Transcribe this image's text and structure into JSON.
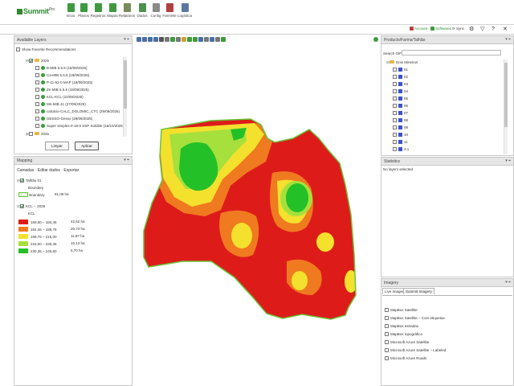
{
  "app": {
    "name": "Summit",
    "name_suffix": "Pro",
    "ribbon": [
      {
        "label": "Início",
        "icon": "home-icon",
        "color": "#3f9a3f"
      },
      {
        "label": "Planos",
        "icon": "plans-icon",
        "color": "#3f9a3f"
      },
      {
        "label": "Registros",
        "icon": "records-icon",
        "color": "#3f9a3f"
      },
      {
        "label": "Mapas",
        "icon": "maps-icon",
        "color": "#3f9a3f"
      },
      {
        "label": "Relatórios",
        "icon": "reports-icon",
        "color": "#7a8a5a"
      },
      {
        "label": "Dados",
        "icon": "data-icon",
        "color": "#4f8f4f"
      },
      {
        "label": "Config",
        "icon": "config-icon",
        "color": "#8a8a8a"
      },
      {
        "label": "FarmWe",
        "icon": "farmwe-icon",
        "color": "#b04040"
      },
      {
        "label": "Logística",
        "icon": "logistics-icon",
        "color": "#5a7aa0"
      }
    ]
  },
  "status_bar": {
    "account": "Account",
    "sw": "Softwares",
    "sync": "Sync",
    "account_color": "#c04040",
    "sw_color": "#3f9a3f"
  },
  "layers_panel": {
    "title": "Available Layers",
    "show_fav": "Show Favorite Recommendations",
    "year": "2025",
    "items": [
      "B-MIB 5.5.5 (18/09/2025)",
      "Ca-MIB 5.5.5 (18/09/2025)",
      "P-11-52-0 MAP (18/09/2025)",
      "Zn-MIB 5.5.5 (18/09/2025)",
      "KCL-KCL (22/09/2025)",
      "Mn-MIB 41 (27/09/2025)",
      "calcário-CALC_DOLOMIC_CTC (29/09/2025)",
      "GESSO-Gesso (29/09/2025)",
      "Super simples-0-18-0 SSP Solúble (16/10/2025)"
    ],
    "next_year": "2026",
    "btn_clear": "Limpar",
    "btn_apply": "Aplicar"
  },
  "mapping_panel": {
    "title": "Mapping",
    "menu": [
      "Camadas",
      "Editar dados",
      "Exportar"
    ],
    "field_name": "Talhão 01",
    "boundary_header": "Boundary",
    "boundary_label": "Boundary",
    "boundary_area": "91,09 ha",
    "layer_name": "KCL -- 2025",
    "layer_sub": "KCL",
    "legend": [
      {
        "range": "169,50 – 184,46",
        "area": "42,62 ha",
        "color": "#dd1c1a"
      },
      {
        "range": "184,46 – 199,76",
        "area": "20,73 ha",
        "color": "#f07a1f"
      },
      {
        "range": "199,76 – 215,00",
        "area": "11,97 ha",
        "color": "#f3e12e"
      },
      {
        "range": "215,00 – 230,36",
        "area": "10,13 ha",
        "color": "#a6e03c"
      },
      {
        "range": "230,36 – 245,60",
        "area": "5,70 ha",
        "color": "#23c027"
      }
    ]
  },
  "products_panel": {
    "title": "Products/Farms/Talhão",
    "search_label": "Search GIF/F:",
    "search_value": "",
    "farm": "Dois Mineiros",
    "fields": [
      "01",
      "02",
      "03",
      "04",
      "05",
      "06",
      "07",
      "08",
      "09",
      "10",
      "11",
      "3.1"
    ]
  },
  "statistics_panel": {
    "title": "Statistics",
    "empty": "No layers selected"
  },
  "imagery_panel": {
    "title": "Imagery",
    "tabs": [
      "Live Imagery",
      "Summit Imagery"
    ],
    "items": [
      "MapBox Satellite",
      "MapBox Satellite – Com etiquetas",
      "MapBox estradas",
      "MapBox topográfico",
      "Microsoft Azure Satellite",
      "Microsoft Azure Satellite – Labeled",
      "Microsoft Azure Roads"
    ]
  },
  "map": {
    "colors": {
      "low": "#dd1c1a",
      "midlow": "#f07a1f",
      "mid": "#f3e12e",
      "midhigh": "#a6e03c",
      "high": "#23c027",
      "border": "#6cc23a"
    }
  }
}
